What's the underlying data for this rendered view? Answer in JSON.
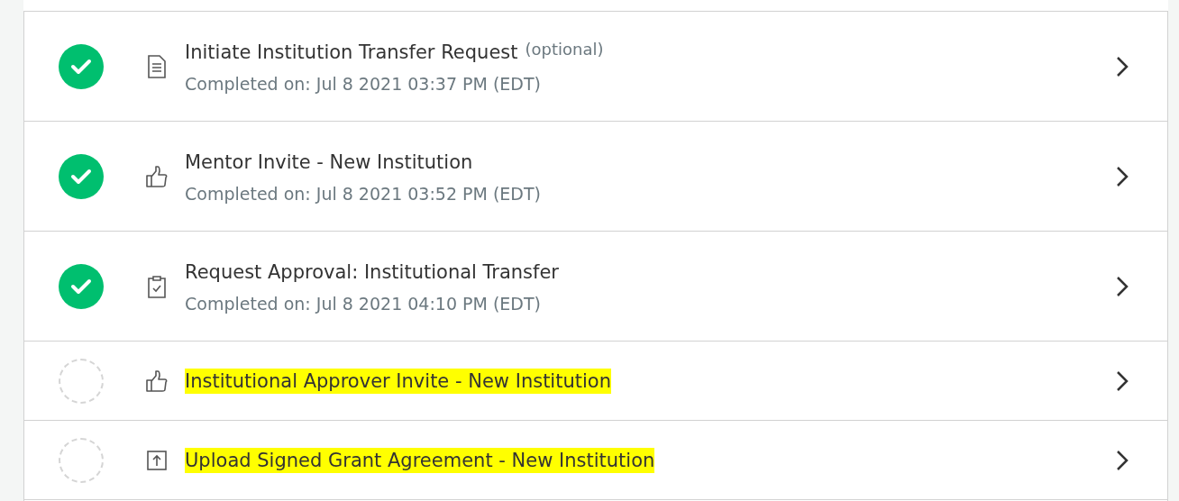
{
  "steps": [
    {
      "title": "Initiate Institution Transfer Request",
      "note": "(optional)",
      "completed_text": "Completed on: Jul 8 2021 03:37 PM (EDT)",
      "completed": true,
      "kind": "document",
      "highlighted": false
    },
    {
      "title": "Mentor Invite - New Institution",
      "completed_text": "Completed on: Jul 8 2021 03:52 PM (EDT)",
      "completed": true,
      "kind": "thumbs-up",
      "highlighted": false
    },
    {
      "title": "Request Approval: Institutional Transfer",
      "completed_text": "Completed on: Jul 8 2021 04:10 PM (EDT)",
      "completed": true,
      "kind": "clipboard",
      "highlighted": false
    },
    {
      "title": "Institutional Approver Invite - New Institution",
      "completed": false,
      "kind": "thumbs-up",
      "highlighted": true
    },
    {
      "title": "Upload Signed Grant Agreement - New Institution",
      "completed": false,
      "kind": "upload",
      "highlighted": true
    }
  ]
}
